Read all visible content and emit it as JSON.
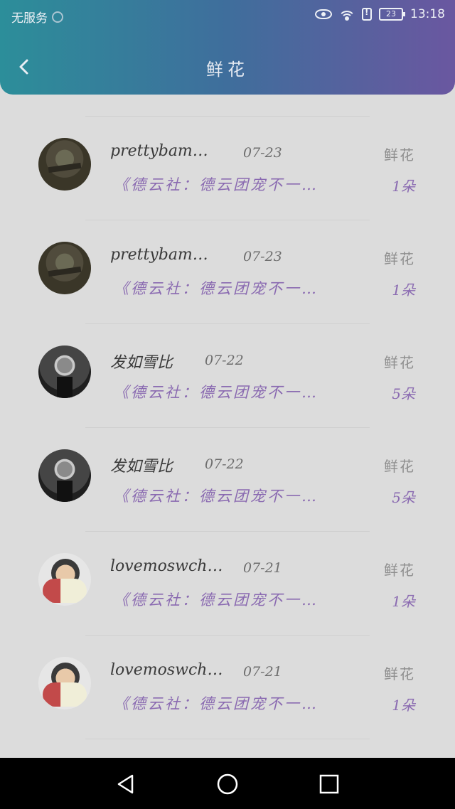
{
  "status_bar": {
    "carrier": "无服务",
    "battery": "23",
    "time": "13:18"
  },
  "header": {
    "title": "鲜花"
  },
  "list": {
    "items": [
      {
        "name": "",
        "date": "",
        "type": "",
        "desc": "《德云社：德云团宠不一…",
        "count": "1朵",
        "avatar": "cartoon"
      },
      {
        "name": "prettybam…",
        "date": "07-23",
        "type": "鲜花",
        "desc": "《德云社：德云团宠不一…",
        "count": "1朵",
        "avatar": "soldier"
      },
      {
        "name": "prettybam…",
        "date": "07-23",
        "type": "鲜花",
        "desc": "《德云社：德云团宠不一…",
        "count": "1朵",
        "avatar": "soldier"
      },
      {
        "name": "发如雪比",
        "date": "07-22",
        "type": "鲜花",
        "desc": "《德云社：德云团宠不一…",
        "count": "5朵",
        "avatar": "man"
      },
      {
        "name": "发如雪比",
        "date": "07-22",
        "type": "鲜花",
        "desc": "《德云社：德云团宠不一…",
        "count": "5朵",
        "avatar": "man"
      },
      {
        "name": "lovemoswch…",
        "date": "07-21",
        "type": "鲜花",
        "desc": "《德云社：德云团宠不一…",
        "count": "1朵",
        "avatar": "cartoon"
      },
      {
        "name": "lovemoswch…",
        "date": "07-21",
        "type": "鲜花",
        "desc": "《德云社：德云团宠不一…",
        "count": "1朵",
        "avatar": "cartoon"
      }
    ]
  },
  "colors": {
    "header_gradient_start": "#2c8e9a",
    "header_gradient_end": "#6a57a0",
    "accent_purple": "#8a6ab1",
    "background": "#dcdcdc"
  }
}
